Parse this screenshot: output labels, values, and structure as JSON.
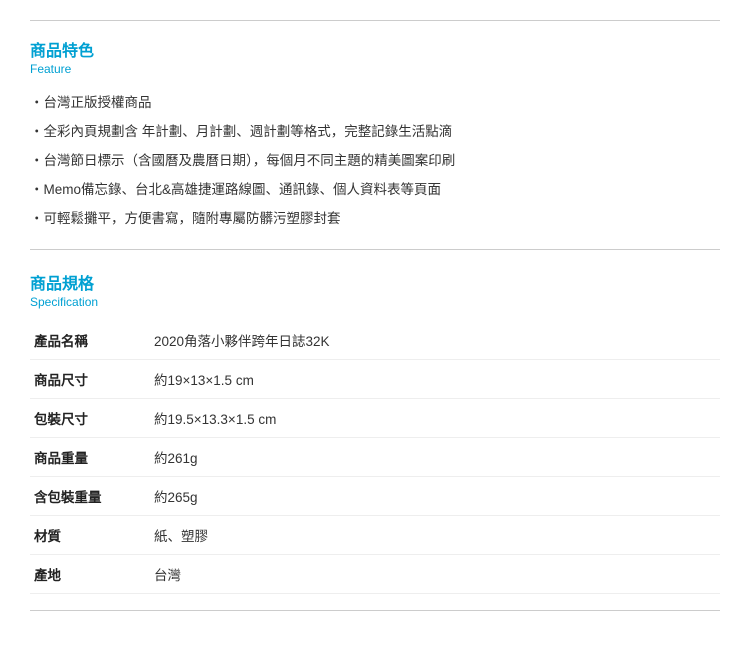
{
  "feature": {
    "title_zh": "商品特色",
    "title_en": "Feature",
    "items": [
      "台灣正版授權商品",
      "全彩內頁規劃含 年計劃、月計劃、週計劃等格式，完整記錄生活點滴",
      "台灣節日標示（含國曆及農曆日期），每個月不同主題的精美圖案印刷",
      "Memo備忘錄、台北&高雄捷運路線圖、通訊錄、個人資料表等頁面",
      "可輕鬆攤平，方便書寫，隨附專屬防髒污塑膠封套"
    ]
  },
  "specification": {
    "title_zh": "商品規格",
    "title_en": "Specification",
    "rows": [
      {
        "label": "產品名稱",
        "value": "2020角落小夥伴跨年日誌32K"
      },
      {
        "label": "商品尺寸",
        "value": "約19×13×1.5 cm"
      },
      {
        "label": "包裝尺寸",
        "value": "約19.5×13.3×1.5 cm"
      },
      {
        "label": "商品重量",
        "value": "約261g"
      },
      {
        "label": "含包裝重量",
        "value": "約265g"
      },
      {
        "label": "材質",
        "value": "紙、塑膠"
      },
      {
        "label": "產地",
        "value": "台灣"
      }
    ]
  }
}
